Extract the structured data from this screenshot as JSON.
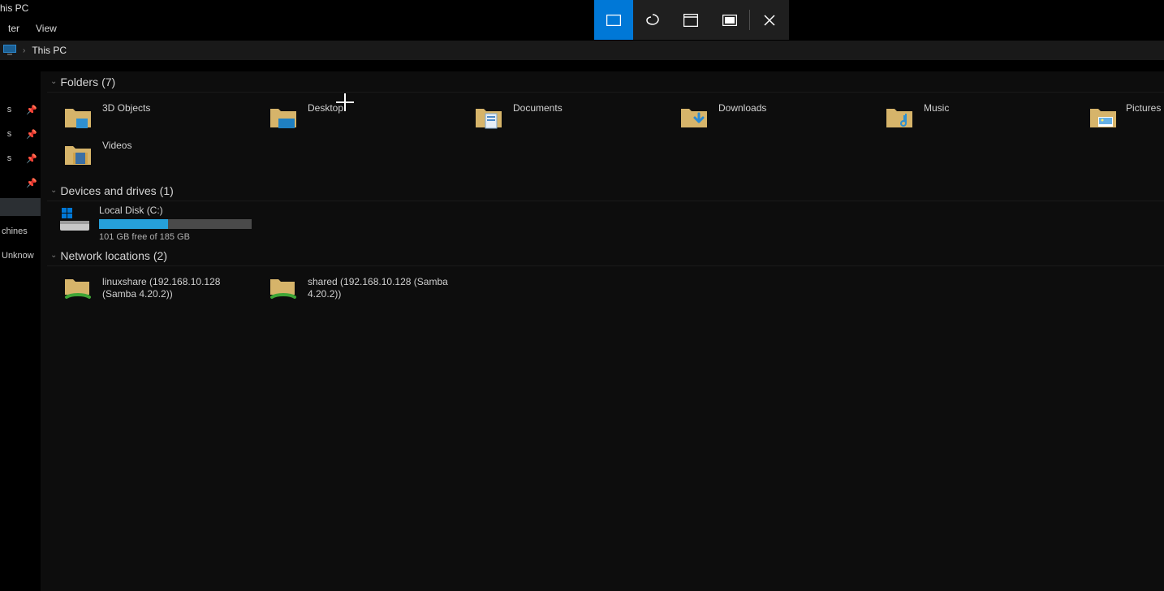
{
  "window": {
    "title_partial": "his PC"
  },
  "menu": {
    "item1_partial": "ter",
    "view": "View"
  },
  "address": {
    "location": "This PC"
  },
  "sidebar": {
    "row1": "s",
    "row2": "s",
    "row3": "s",
    "selected": "",
    "label_machines": "chines",
    "label_unknown": "Unknow"
  },
  "groups": {
    "folders": {
      "title": "Folders",
      "count": "(7)"
    },
    "drives": {
      "title": "Devices and drives",
      "count": "(1)"
    },
    "network": {
      "title": "Network locations",
      "count": "(2)"
    }
  },
  "folders": [
    {
      "name": "3D Objects"
    },
    {
      "name": "Desktop"
    },
    {
      "name": "Documents"
    },
    {
      "name": "Downloads"
    },
    {
      "name": "Music"
    },
    {
      "name": "Pictures"
    },
    {
      "name": "Videos"
    }
  ],
  "drive": {
    "name": "Local Disk (C:)",
    "free_text": "101 GB free of 185 GB",
    "used_percent": 45
  },
  "network": [
    {
      "name": "linuxshare (192.168.10.128 (Samba 4.20.2))"
    },
    {
      "name": "shared (192.168.10.128 (Samba 4.20.2))"
    }
  ],
  "snip": {
    "rect": "rectangular-snip-icon",
    "free": "freeform-snip-icon",
    "window": "window-snip-icon",
    "full": "fullscreen-snip-icon",
    "close": "close-icon"
  }
}
